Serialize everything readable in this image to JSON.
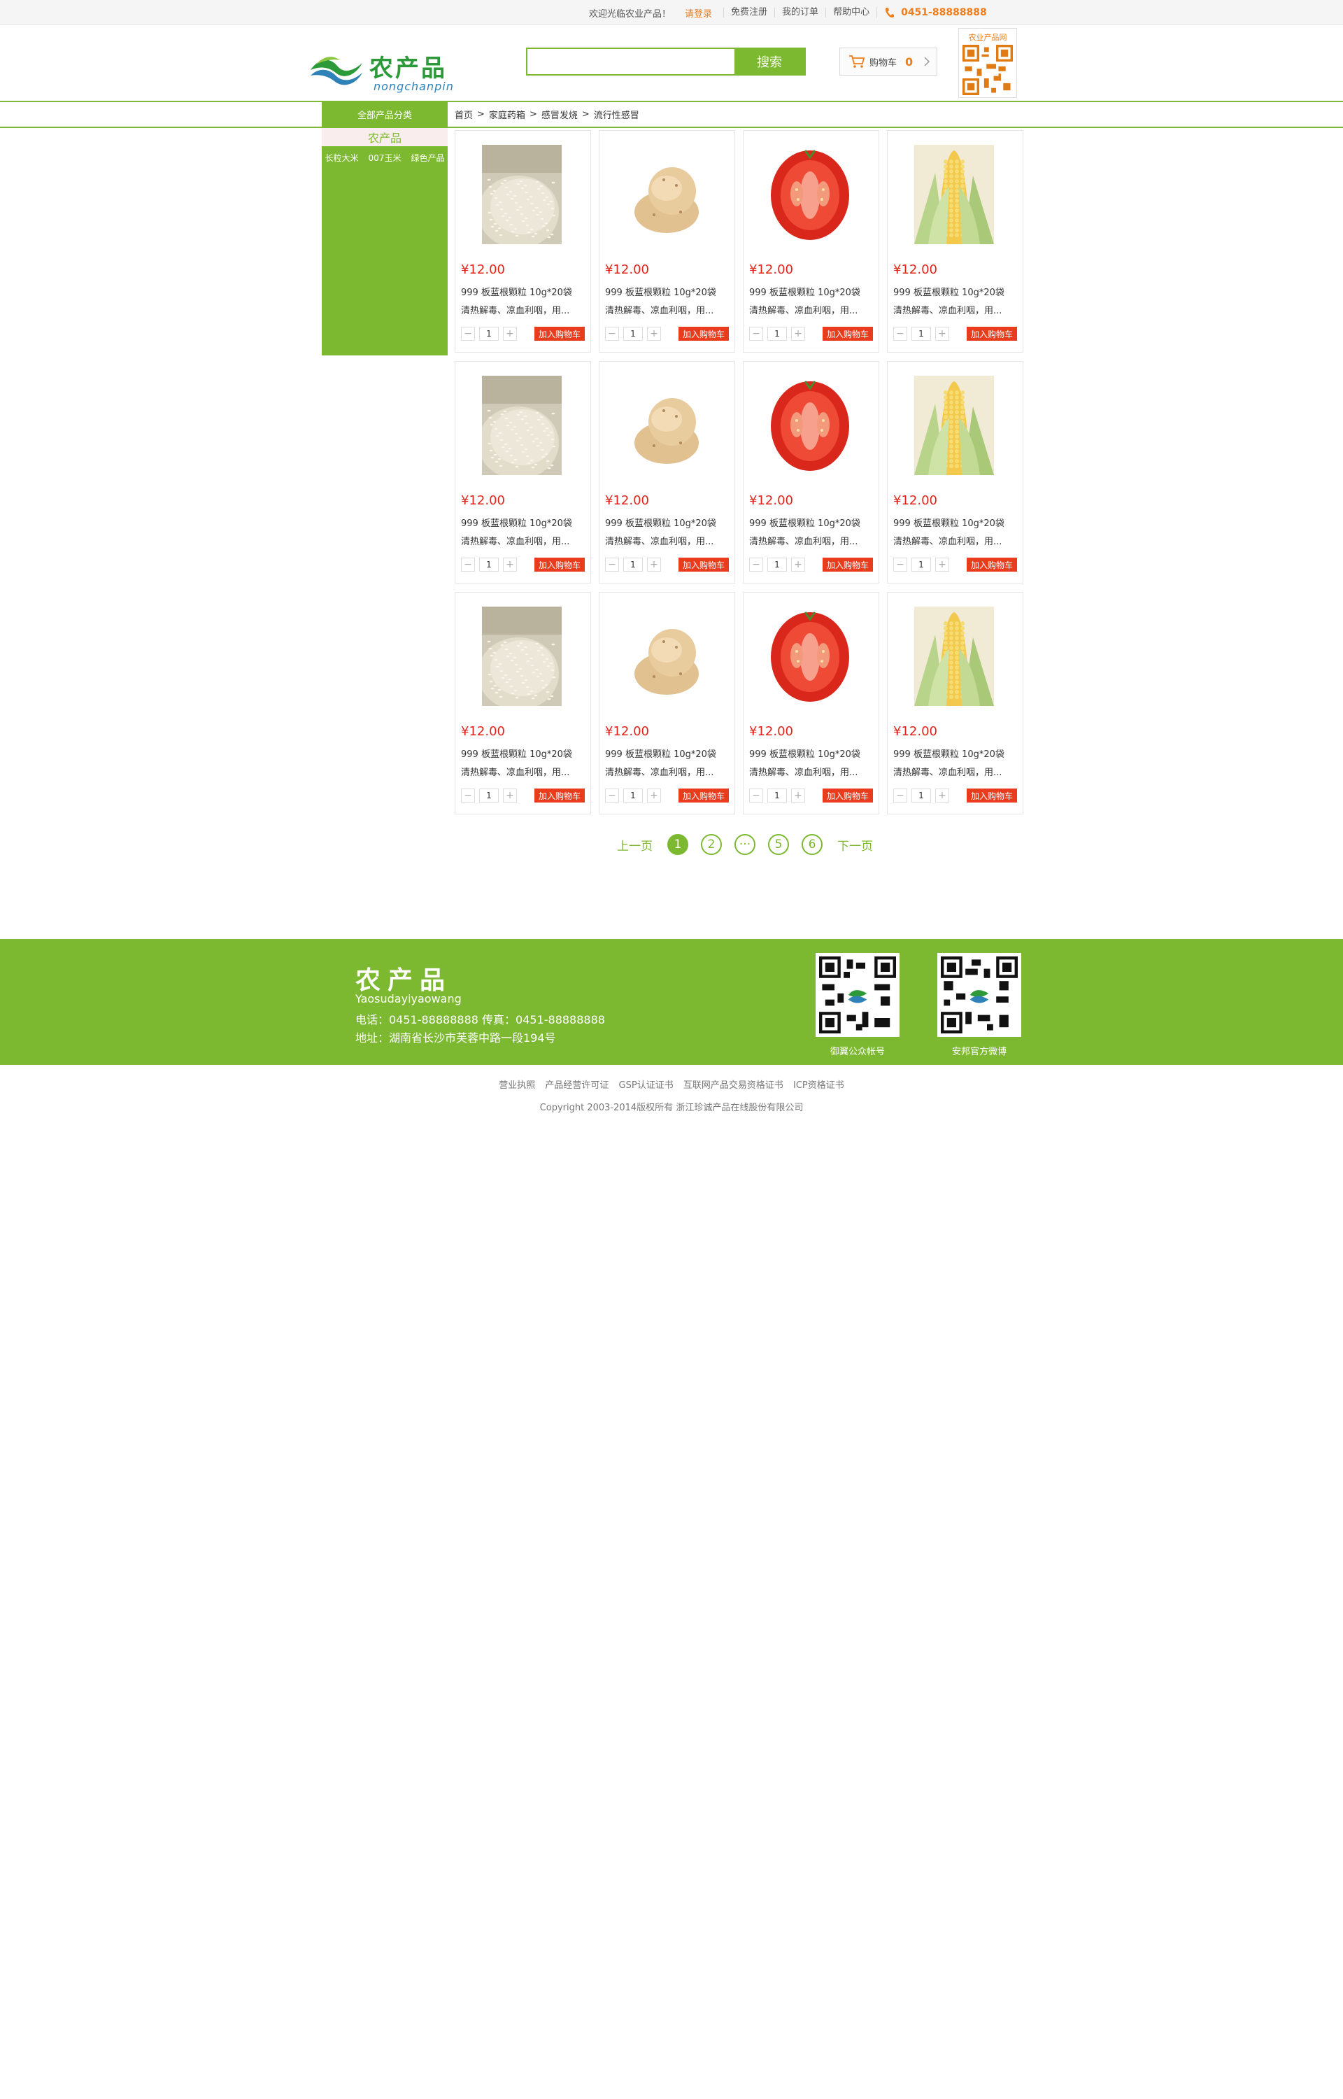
{
  "topbar": {
    "welcome": "欢迎光临农业产品！",
    "login": "请登录",
    "links": [
      "免费注册",
      "我的订单",
      "帮助中心"
    ],
    "phone": "0451-88888888"
  },
  "header": {
    "logo_cn": "农产品",
    "logo_py": "nongchanpin",
    "search_placeholder": "",
    "search_button": "搜索",
    "cart_label": "购物车",
    "cart_count": "0",
    "qr_caption": "农业产品网"
  },
  "nav": {
    "category_title": "全部产品分类",
    "breadcrumb": [
      "首页",
      "家庭药箱",
      "感冒发烧",
      "流行性感冒"
    ],
    "separator": ">"
  },
  "sidebar": {
    "title": "农产品",
    "items": [
      "长粒大米",
      "007玉米",
      "绿色产品"
    ]
  },
  "products": [
    {
      "image": "rice",
      "price": "¥12.00",
      "name": "999 板蓝根颗粒 10g*20袋",
      "desc": "清热解毒、凉血利咽，用...",
      "qty": "1",
      "add_label": "加入购物车"
    },
    {
      "image": "potato",
      "price": "¥12.00",
      "name": "999 板蓝根颗粒 10g*20袋",
      "desc": "清热解毒、凉血利咽，用...",
      "qty": "1",
      "add_label": "加入购物车"
    },
    {
      "image": "tomato",
      "price": "¥12.00",
      "name": "999 板蓝根颗粒 10g*20袋",
      "desc": "清热解毒、凉血利咽，用...",
      "qty": "1",
      "add_label": "加入购物车"
    },
    {
      "image": "corn",
      "price": "¥12.00",
      "name": "999 板蓝根颗粒 10g*20袋",
      "desc": "清热解毒、凉血利咽，用...",
      "qty": "1",
      "add_label": "加入购物车"
    },
    {
      "image": "rice",
      "price": "¥12.00",
      "name": "999 板蓝根颗粒 10g*20袋",
      "desc": "清热解毒、凉血利咽，用...",
      "qty": "1",
      "add_label": "加入购物车"
    },
    {
      "image": "potato",
      "price": "¥12.00",
      "name": "999 板蓝根颗粒 10g*20袋",
      "desc": "清热解毒、凉血利咽，用...",
      "qty": "1",
      "add_label": "加入购物车"
    },
    {
      "image": "tomato",
      "price": "¥12.00",
      "name": "999 板蓝根颗粒 10g*20袋",
      "desc": "清热解毒、凉血利咽，用...",
      "qty": "1",
      "add_label": "加入购物车"
    },
    {
      "image": "corn",
      "price": "¥12.00",
      "name": "999 板蓝根颗粒 10g*20袋",
      "desc": "清热解毒、凉血利咽，用...",
      "qty": "1",
      "add_label": "加入购物车"
    },
    {
      "image": "rice",
      "price": "¥12.00",
      "name": "999 板蓝根颗粒 10g*20袋",
      "desc": "清热解毒、凉血利咽，用...",
      "qty": "1",
      "add_label": "加入购物车"
    },
    {
      "image": "potato",
      "price": "¥12.00",
      "name": "999 板蓝根颗粒 10g*20袋",
      "desc": "清热解毒、凉血利咽，用...",
      "qty": "1",
      "add_label": "加入购物车"
    },
    {
      "image": "tomato",
      "price": "¥12.00",
      "name": "999 板蓝根颗粒 10g*20袋",
      "desc": "清热解毒、凉血利咽，用...",
      "qty": "1",
      "add_label": "加入购物车"
    },
    {
      "image": "corn",
      "price": "¥12.00",
      "name": "999 板蓝根颗粒 10g*20袋",
      "desc": "清热解毒、凉血利咽，用...",
      "qty": "1",
      "add_label": "加入购物车"
    }
  ],
  "pager": {
    "prev": "上一页",
    "next": "下一页",
    "pages": [
      "1",
      "2",
      "···",
      "5",
      "6"
    ],
    "active": "1"
  },
  "footer": {
    "title": "农产品",
    "subtitle": "Yaosudayiyaowang",
    "tel": "电话：0451-88888888  传真：0451-88888888",
    "address": "地址：湖南省长沙市芙蓉中路一段194号",
    "qr1_caption": "御翼公众帐号",
    "qr2_caption": "安邦官方微博",
    "links": [
      "营业执照",
      "产品经营许可证",
      "GSP认证证书",
      "互联网产品交易资格证书",
      "ICP资格证书"
    ],
    "copyright": "Copyright 2003-2014版权所有 浙江珍诚产品在线股份有限公司"
  },
  "colors": {
    "brand_green": "#7cb930",
    "accent_orange": "#f07c1a",
    "price_red": "#e2231a",
    "add_button": "#e83c1d"
  },
  "icons": [
    "phone-icon",
    "cart-icon",
    "chevron-right-icon",
    "logo-wave-icon",
    "qr-code-icon"
  ]
}
